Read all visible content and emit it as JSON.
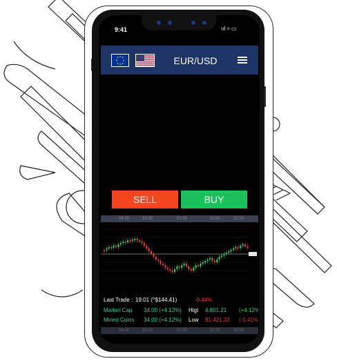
{
  "status": {
    "time": "9:41",
    "icons": "ııl ≈ ▭"
  },
  "header": {
    "pair": "EUR/USD",
    "flag_left": "eu-flag-icon",
    "flag_right": "us-flag-icon",
    "menu_icon": "hamburger-menu-icon"
  },
  "actions": {
    "sell_label": "SELL",
    "buy_label": "BUY",
    "sell_color": "#f2471e",
    "buy_color": "#1ac05a"
  },
  "time_axis": [
    "04:00",
    "15:00",
    "01:00",
    "11:00",
    "22:00"
  ],
  "info": {
    "last_trade_label": "Last Trade :",
    "last_trade_value": "19:01 (^$144.41)",
    "last_trade_change": "-0.44%",
    "market_cap_label": "Market Cap",
    "market_cap_value": "34.00 (+4.12%)",
    "high_label": "Higt",
    "high_value": "4.801.21",
    "high_change": "(+4.12%",
    "mined_coins_label": "Mined Coins",
    "mined_coins_value": "34.00 (+4.12%)",
    "low_label": "Low",
    "low_value": "$1,421.33",
    "low_change": "(-1.41%"
  },
  "bottom_axis": [
    "04:00",
    "15:00",
    "01:00",
    "11:00",
    "22:00"
  ]
}
